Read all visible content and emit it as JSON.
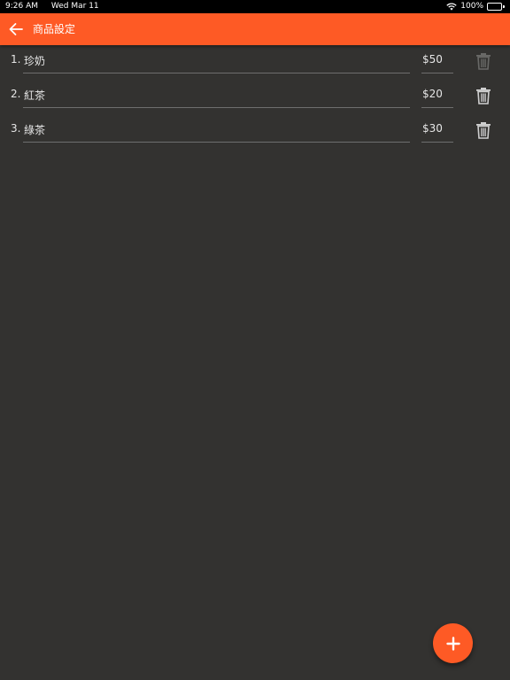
{
  "status_bar": {
    "time": "9:26 AM",
    "date": "Wed Mar 11",
    "battery": "100%",
    "battery_level": 1.0
  },
  "app_bar": {
    "title": "商品設定",
    "back_icon": "arrow-left-icon"
  },
  "products": [
    {
      "index": "1.",
      "name": "珍奶",
      "price": "$50",
      "delete_enabled": false
    },
    {
      "index": "2.",
      "name": "紅茶",
      "price": "$20",
      "delete_enabled": true
    },
    {
      "index": "3.",
      "name": "綠茶",
      "price": "$30",
      "delete_enabled": true
    }
  ],
  "fab": {
    "icon": "plus-icon"
  },
  "colors": {
    "accent": "#fe5a25",
    "background": "#333230",
    "text": "#e6e6e6",
    "underline": "#6e6e6e"
  }
}
